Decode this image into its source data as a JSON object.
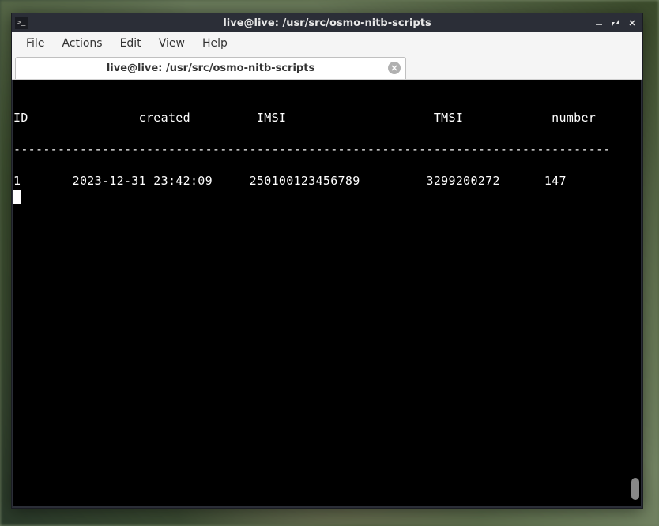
{
  "window": {
    "title": "live@live: /usr/src/osmo-nitb-scripts"
  },
  "menubar": {
    "file": "File",
    "actions": "Actions",
    "edit": "Edit",
    "view": "View",
    "help": "Help"
  },
  "tab": {
    "label": "live@live: /usr/src/osmo-nitb-scripts"
  },
  "terminal": {
    "header_line": "ID               created         IMSI                    TMSI            number",
    "divider_line": "---------------------------------------------------------------------------------",
    "row1_line": "1       2023-12-31 23:42:09     250100123456789         3299200272      147"
  }
}
